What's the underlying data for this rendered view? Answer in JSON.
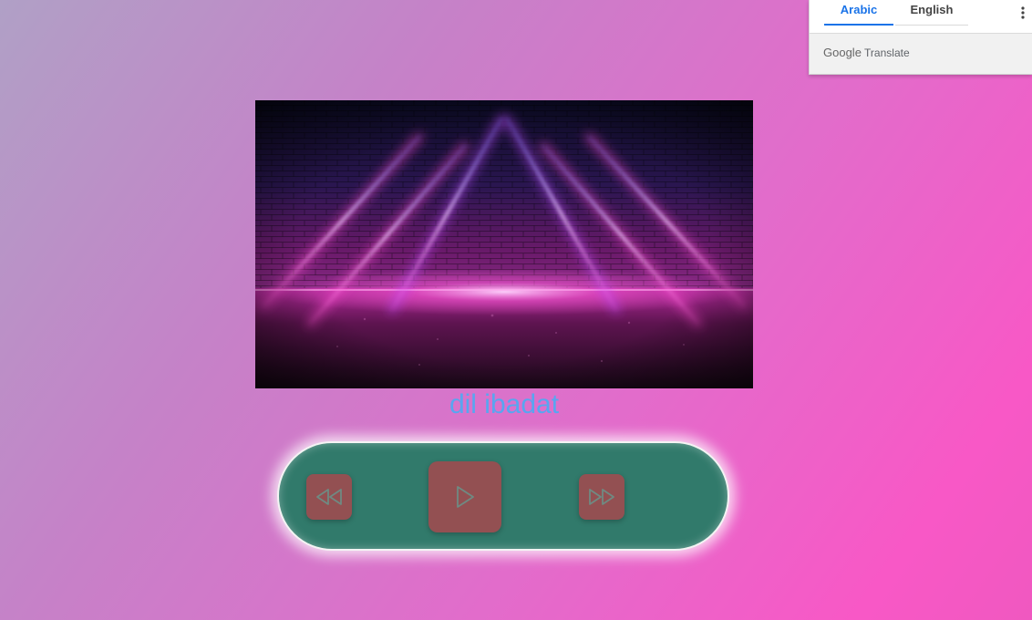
{
  "player": {
    "song_title": "dil ibadat",
    "art_icon": "neon-stage-image",
    "buttons": {
      "previous_icon": "rewind-icon",
      "play_icon": "play-icon",
      "next_icon": "fast-forward-icon"
    },
    "colors": {
      "bar": "#317a6b",
      "button": "#935052",
      "title": "#58a6f0"
    }
  },
  "translate_popup": {
    "tabs": [
      "Arabic",
      "English"
    ],
    "active_tab": "Arabic",
    "brand_google": "Google",
    "brand_translate": "Translate",
    "menu_icon": "more-vert-icon"
  }
}
